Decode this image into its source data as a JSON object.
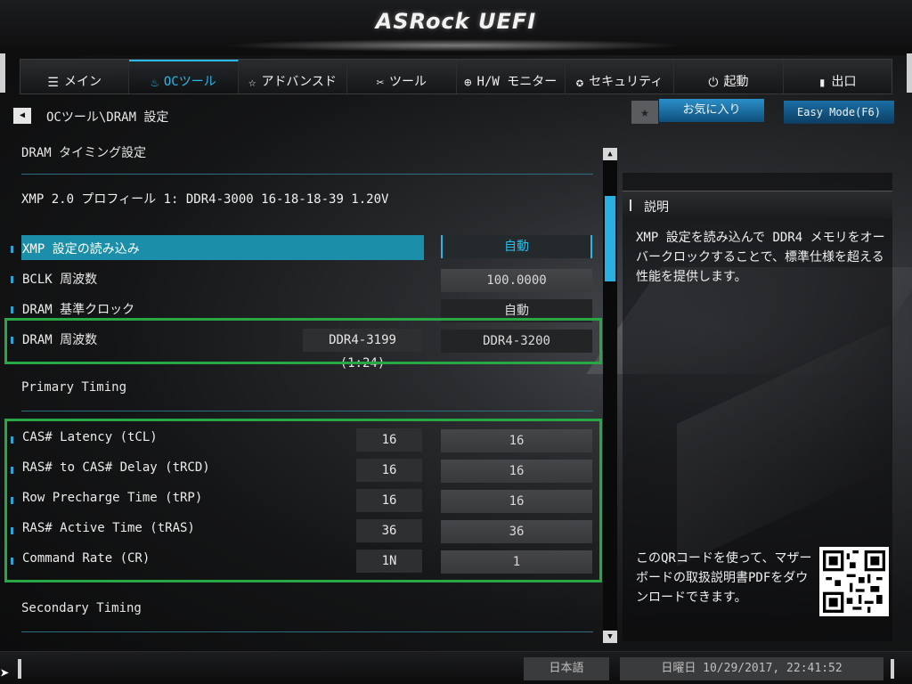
{
  "app": {
    "logo": "ASRock UEFI"
  },
  "tabs": [
    {
      "label": "メイン",
      "icon": "list-icon",
      "glyph": "☰"
    },
    {
      "label": "OCツール",
      "icon": "flame-icon",
      "glyph": "♨"
    },
    {
      "label": "アドバンスド",
      "icon": "star-icon",
      "glyph": "☆"
    },
    {
      "label": "ツール",
      "icon": "tools-icon",
      "glyph": "✂"
    },
    {
      "label": "H/W モニター",
      "icon": "globe-icon",
      "glyph": "⊕"
    },
    {
      "label": "セキュリティ",
      "icon": "shield-icon",
      "glyph": "✪"
    },
    {
      "label": "起動",
      "icon": "power-icon",
      "glyph": "⏻"
    },
    {
      "label": "出口",
      "icon": "exit-icon",
      "glyph": "▮"
    }
  ],
  "breadcrumb": "OCツール\\DRAM 設定",
  "favorites_label": "お気に入り",
  "easy_mode_label": "Easy Mode(F6)",
  "main": {
    "section_dram_timing": "DRAM タイミング設定",
    "xmp_profile": "XMP 2.0 プロフィール 1: DDR4-3000 16-18-18-39 1.20V",
    "rows": [
      {
        "label": "XMP 設定の読み込み",
        "current": "",
        "value": "自動"
      },
      {
        "label": "BCLK 周波数",
        "current": "",
        "value": "100.0000"
      },
      {
        "label": "DRAM 基準クロック",
        "current": "",
        "value": "自動"
      },
      {
        "label": "DRAM 周波数",
        "current": "DDR4-3199 (1:24)",
        "value": "DDR4-3200"
      }
    ],
    "section_primary": "Primary Timing",
    "primary_rows": [
      {
        "label": "CAS# Latency (tCL)",
        "current": "16",
        "value": "16"
      },
      {
        "label": "RAS# to CAS# Delay (tRCD)",
        "current": "16",
        "value": "16"
      },
      {
        "label": "Row Precharge Time (tRP)",
        "current": "16",
        "value": "16"
      },
      {
        "label": "RAS# Active Time (tRAS)",
        "current": "36",
        "value": "36"
      },
      {
        "label": "Command Rate (CR)",
        "current": "1N",
        "value": "1"
      }
    ],
    "section_secondary": "Secondary Timing"
  },
  "description": {
    "title": "説明",
    "text": "XMP 設定を読み込んで DDR4 メモリをオーバークロックすることで、標準仕様を超える性能を提供します。",
    "qr_text": "このQRコードを使って、マザーボードの取扱説明書PDFをダウンロードできます。"
  },
  "status": {
    "language": "日本語",
    "datetime": "日曜日 10/29/2017, 22:41:52"
  },
  "colors": {
    "accent": "#29b8e8",
    "highlight_row": "#1b8faa",
    "annotation_box": "#27a844"
  }
}
